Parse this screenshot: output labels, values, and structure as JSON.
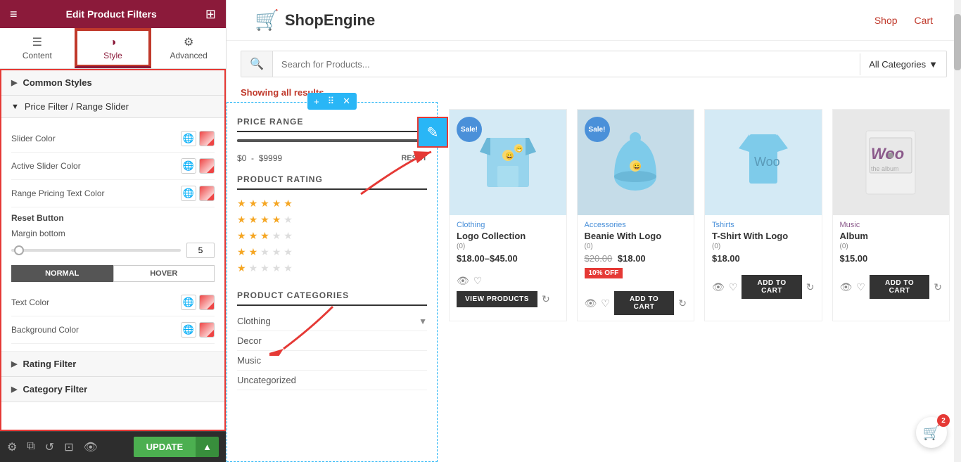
{
  "leftPanel": {
    "header": {
      "title": "Edit Product Filters",
      "menuIcon": "≡",
      "gridIcon": "⊞"
    },
    "tabs": [
      {
        "id": "content",
        "label": "Content",
        "icon": "☰"
      },
      {
        "id": "style",
        "label": "Style",
        "icon": "◑",
        "active": true
      },
      {
        "id": "advanced",
        "label": "Advanced",
        "icon": "⚙"
      }
    ],
    "sections": [
      {
        "id": "common-styles",
        "label": "Common Styles",
        "expanded": true
      },
      {
        "id": "price-filter",
        "label": "Price Filter / Range Slider",
        "expanded": true,
        "controls": [
          {
            "id": "slider-color",
            "label": "Slider Color"
          },
          {
            "id": "active-slider-color",
            "label": "Active Slider Color"
          },
          {
            "id": "range-pricing-text-color",
            "label": "Range Pricing Text Color"
          }
        ],
        "resetButton": {
          "label": "Reset Button",
          "marginBottom": {
            "label": "Margin bottom",
            "value": "5"
          },
          "states": [
            {
              "label": "NORMAL",
              "active": true
            },
            {
              "label": "HOVER",
              "active": false
            }
          ],
          "textColor": {
            "label": "Text Color"
          },
          "backgroundColor": {
            "label": "Background Color"
          }
        }
      },
      {
        "id": "rating-filter",
        "label": "Rating Filter",
        "expanded": false
      },
      {
        "id": "category-filter",
        "label": "Category Filter",
        "expanded": false
      }
    ],
    "footer": {
      "updateLabel": "UPDATE"
    }
  },
  "shopHeader": {
    "logoText": "ShopEngine",
    "navItems": [
      {
        "label": "Shop"
      },
      {
        "label": "Cart"
      }
    ]
  },
  "searchBar": {
    "placeholder": "Search for Products...",
    "categoryLabel": "All Categories"
  },
  "showingText": "Showing all results",
  "filterPanel": {
    "priceRange": {
      "title": "PRICE RANGE",
      "minPrice": "$0",
      "maxPrice": "$9999",
      "resetLabel": "RESET"
    },
    "productRating": {
      "title": "PRODUCT RATING",
      "ratings": [
        5,
        4,
        3,
        2,
        1
      ]
    },
    "productCategories": {
      "title": "PRODUCT CATEGORIES",
      "items": [
        {
          "label": "Clothing",
          "hasChildren": true
        },
        {
          "label": "Decor",
          "hasChildren": false
        },
        {
          "label": "Music",
          "hasChildren": false
        },
        {
          "label": "Uncategorized",
          "hasChildren": false
        }
      ]
    }
  },
  "products": [
    {
      "id": 1,
      "category": "Clothing",
      "name": "Logo Collection",
      "rating": "(0)",
      "price": "$18.00–$45.00",
      "hasSale": true,
      "imgType": "clothing",
      "action": "VIEW PRODUCTS"
    },
    {
      "id": 2,
      "category": "Accessories",
      "name": "Beanie With Logo",
      "rating": "(0)",
      "oldPrice": "$20.00",
      "price": "$18.00",
      "discount": "10% OFF",
      "hasSale": true,
      "imgType": "accessories",
      "action": "ADD TO CART"
    },
    {
      "id": 3,
      "category": "Tshirts",
      "name": "T-Shirt With Logo",
      "rating": "(0)",
      "price": "$18.00",
      "hasSale": false,
      "imgType": "tshirt",
      "action": "ADD TO CART"
    },
    {
      "id": 4,
      "category": "Music",
      "name": "Album",
      "rating": "(0)",
      "price": "$15.00",
      "hasSale": false,
      "imgType": "music",
      "action": "ADD TO CART"
    }
  ],
  "cart": {
    "count": "2"
  }
}
